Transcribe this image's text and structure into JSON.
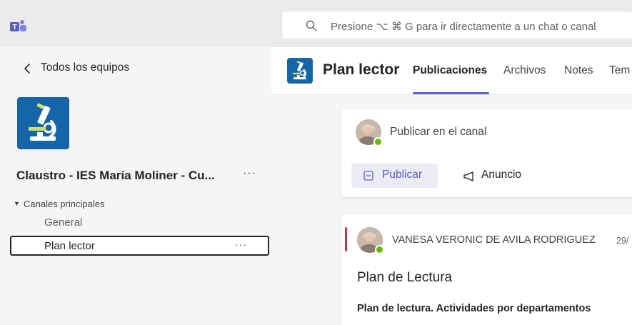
{
  "search": {
    "placeholder": "Presione ⌥ ⌘ G para ir directamente a un chat o canal"
  },
  "sidebar": {
    "back_label": "Todos los equipos",
    "team_name": "Claustro - IES María Moliner - Cu...",
    "more_label": "···",
    "section_label": "Canales principales",
    "channels": [
      {
        "label": "General",
        "selected": false
      },
      {
        "label": "Plan lector",
        "selected": true
      }
    ]
  },
  "header": {
    "channel_title": "Plan lector",
    "tabs": [
      {
        "label": "Publicaciones",
        "active": true
      },
      {
        "label": "Archivos",
        "active": false
      },
      {
        "label": "Notes",
        "active": false
      },
      {
        "label": "Tem",
        "active": false
      }
    ]
  },
  "compose": {
    "prompt": "Publicar en el canal",
    "publish_label": "Publicar",
    "announce_label": "Anuncio"
  },
  "post": {
    "author": "VANESA VERONIC DE AVILA RODRIGUEZ",
    "date": "29/",
    "title": "Plan de Lectura",
    "subtitle": "Plan de lectura. Actividades por departamentos"
  },
  "colors": {
    "accent": "#5b5fc7",
    "team_icon_bg": "#1566a8",
    "presence": "#6bb700",
    "post_accent": "#c4314b"
  },
  "icons": [
    "teams-logo-icon",
    "search-icon",
    "chevron-left-icon",
    "microscope-icon",
    "caret-down-icon",
    "more-icon",
    "compose-icon",
    "megaphone-icon"
  ]
}
